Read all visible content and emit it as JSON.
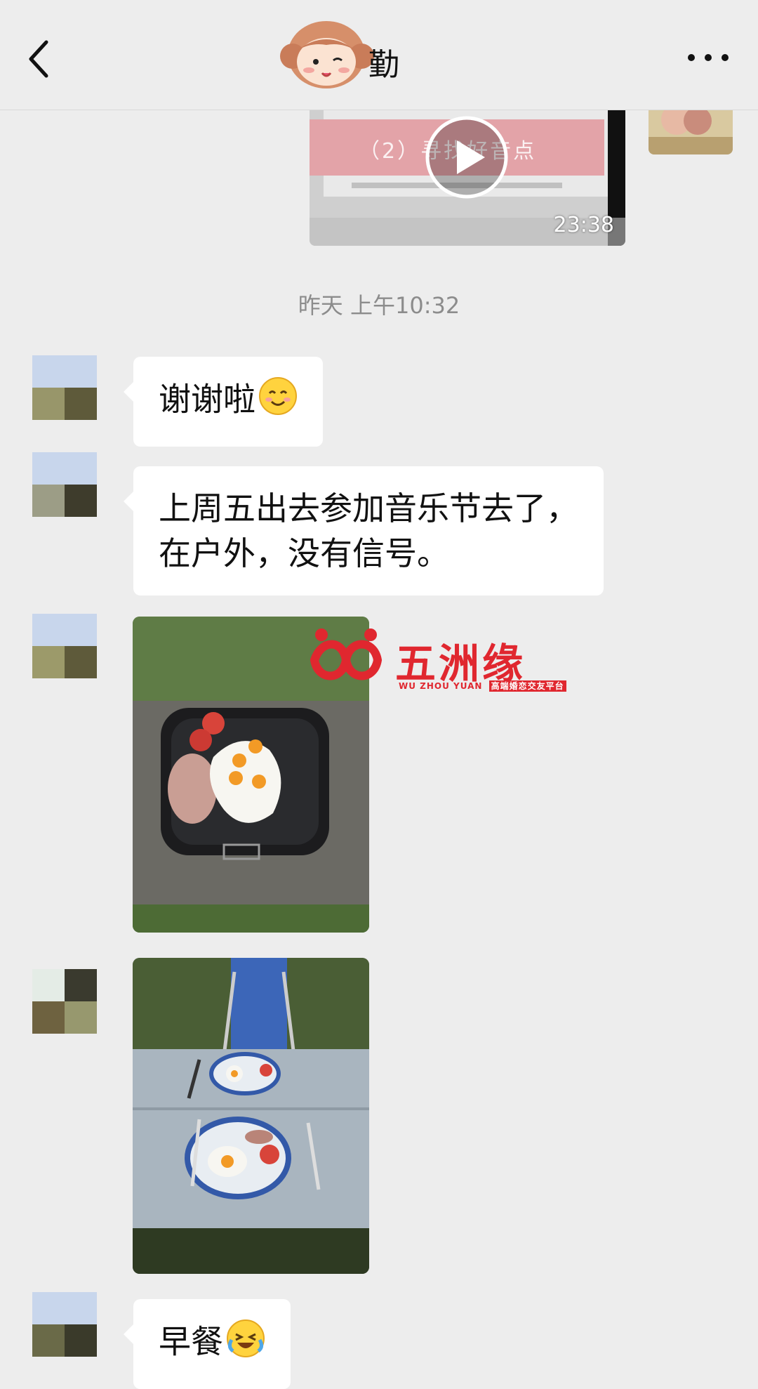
{
  "header": {
    "title": "勤",
    "back_icon": "chevron-left-icon",
    "more_icon": "more-dots-icon"
  },
  "video": {
    "duration": "23:38",
    "overlay_text": "（2）寻找好音点",
    "play_icon": "play-icon"
  },
  "timestamp": "昨天 上午10:32",
  "messages": [
    {
      "type": "text",
      "text": "谢谢啦",
      "emoji": "smile-emoji"
    },
    {
      "type": "text",
      "line1": "上周五出去参加音乐节去了，",
      "line2": "在户外，没有信号。"
    },
    {
      "type": "image",
      "description_icon": "photo-grill-breakfast"
    },
    {
      "type": "image",
      "description_icon": "photo-table-breakfast"
    },
    {
      "type": "text",
      "text": "早餐",
      "emoji": "laugh-cry-emoji"
    }
  ],
  "watermark": {
    "brand": "五洲缘",
    "sub_left": "WU ZHOU YUAN",
    "sub_right": "高端婚恋交友平台"
  },
  "colors": {
    "background": "#EDEDED",
    "bubble": "#FFFFFF",
    "brand_red": "#E0272F"
  }
}
